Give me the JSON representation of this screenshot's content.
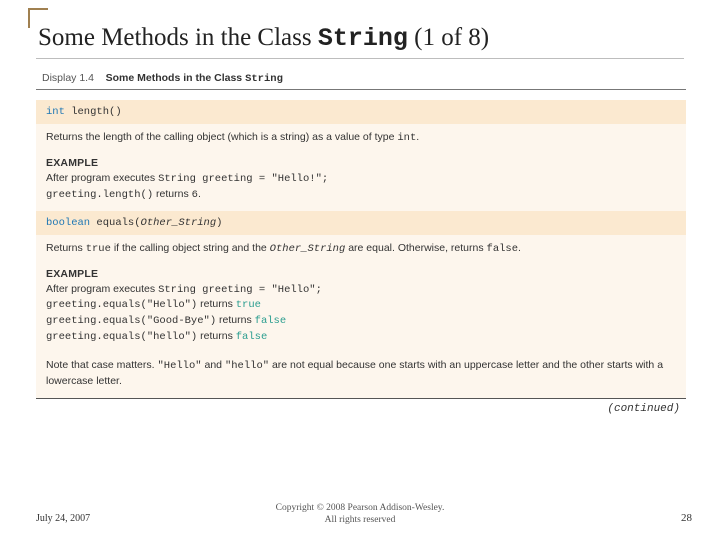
{
  "title": {
    "pre": "Some Methods in the Class ",
    "code": "String",
    "post": " (1 of 8)"
  },
  "display": {
    "label": "Display 1.4",
    "heading_pre": "Some Methods in the Class ",
    "heading_code": "String"
  },
  "methods": [
    {
      "sig": {
        "ret_kw": "int",
        "name": " length()"
      },
      "desc": "Returns the length of the calling object (which is a string) as a value of type int.",
      "example_label": "EXAMPLE",
      "example": "After program executes String greeting = \"Hello!\";\ngreeting.length() returns 6."
    },
    {
      "sig": {
        "ret_kw": "boolean",
        "name": " equals(",
        "arg_italic": "Other_String",
        "close": ")"
      },
      "desc": "Returns true if the calling object string and the Other_String are equal. Otherwise, returns false.",
      "example_label": "EXAMPLE",
      "example_lead": "After program executes ",
      "example_code1": "String greeting = \"Hello\";",
      "lines": [
        {
          "call": "greeting.equals(\"Hello\")",
          "verb": " returns ",
          "val": "true"
        },
        {
          "call": "greeting.equals(\"Good-Bye\")",
          "verb": " returns ",
          "val": "false"
        },
        {
          "call": "greeting.equals(\"hello\")",
          "verb": " returns ",
          "val": "false"
        }
      ],
      "note": "Note that case matters. \"Hello\" and \"hello\" are not equal because one starts with an uppercase letter and the other starts with a lowercase letter."
    }
  ],
  "continued": "(continued)",
  "footer": {
    "date": "July 24, 2007",
    "copy1": "Copyright © 2008 Pearson Addison-Wesley.",
    "copy2": "All rights reserved",
    "page": "28"
  }
}
